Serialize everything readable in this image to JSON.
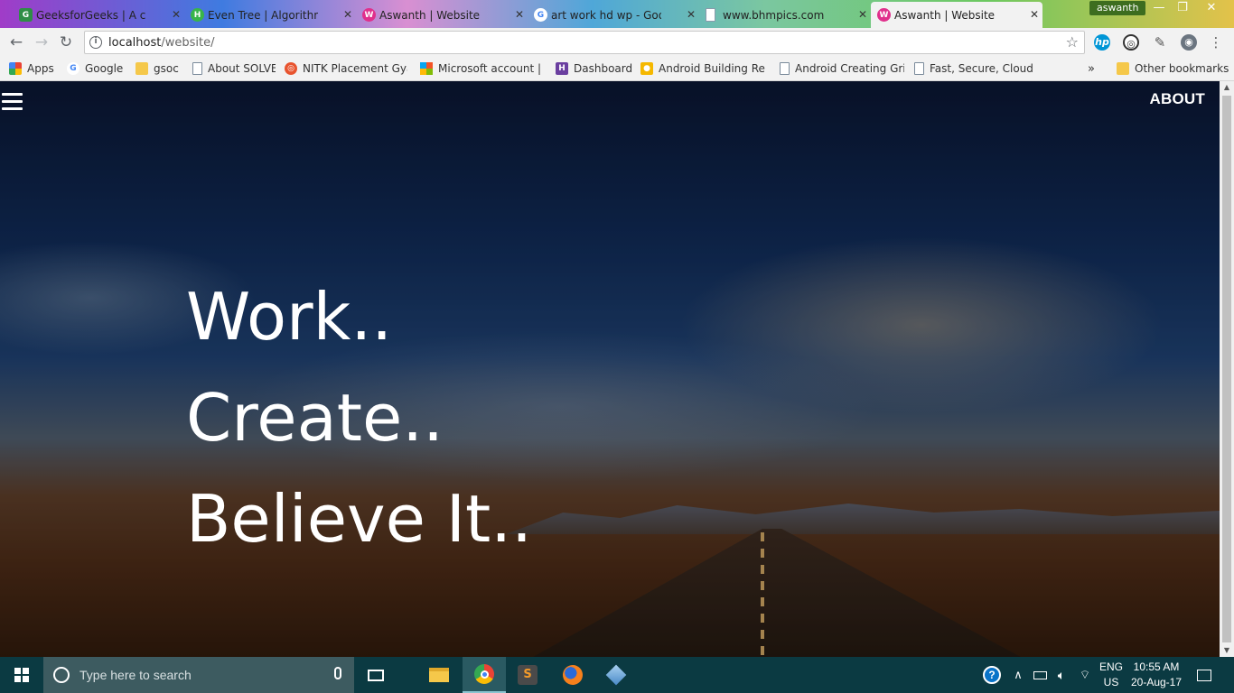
{
  "browser": {
    "tabs": [
      {
        "title": "GeeksforGeeks | A comp",
        "favicon": "geeksforgeeks-icon",
        "color": "#2f8d46",
        "active": false
      },
      {
        "title": "Even Tree | Algorithms C",
        "favicon": "hackerrank-icon",
        "color": "#39b54a",
        "active": false
      },
      {
        "title": "Aswanth | Website",
        "favicon": "website-icon",
        "color": "#e0308c",
        "active": false
      },
      {
        "title": "art work hd wp - Googl",
        "favicon": "google-icon",
        "color": "#4285f4",
        "active": false
      },
      {
        "title": "www.bhmpics.com",
        "favicon": "page-icon",
        "color": "#8a9aac",
        "active": false
      },
      {
        "title": "Aswanth | Website",
        "favicon": "website-icon",
        "color": "#e0308c",
        "active": true
      }
    ],
    "profile_name": "aswanth",
    "address": {
      "host": "localhost",
      "path": "/website/"
    },
    "bookmarks": [
      {
        "label": "Apps",
        "type": "apps"
      },
      {
        "label": "Google",
        "type": "google"
      },
      {
        "label": "gsoc",
        "type": "folder"
      },
      {
        "label": "About SOLVE",
        "type": "page"
      },
      {
        "label": "NITK Placement Gyan",
        "type": "nitk"
      },
      {
        "label": "Microsoft account | H",
        "type": "microsoft"
      },
      {
        "label": "Dashboard",
        "type": "dashboard"
      },
      {
        "label": "Android Building Rea",
        "type": "android"
      },
      {
        "label": "Android Creating Gri",
        "type": "page"
      },
      {
        "label": "Fast, Secure, Cloud C",
        "type": "page"
      }
    ],
    "more_bookmarks": "»",
    "other_bookmarks": "Other bookmarks"
  },
  "page": {
    "nav": {
      "about_label": "ABOUT"
    },
    "tagline": [
      "Work..",
      "Create..",
      "Believe It.."
    ]
  },
  "taskbar": {
    "search_placeholder": "Type here to search",
    "language": {
      "line1": "ENG",
      "line2": "US"
    },
    "time": "10:55 AM",
    "date": "20-Aug-17"
  }
}
